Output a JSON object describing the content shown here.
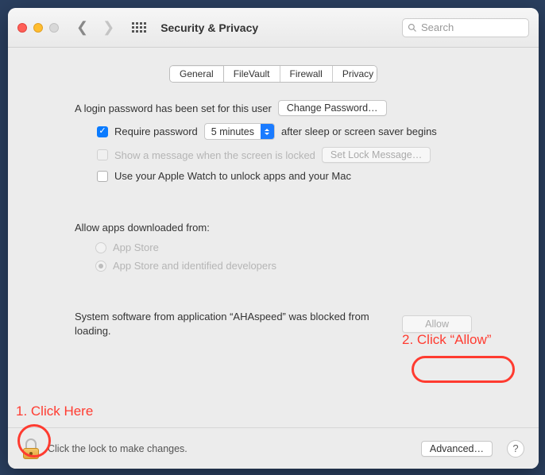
{
  "window": {
    "title": "Security & Privacy",
    "search_placeholder": "Search"
  },
  "tabs": {
    "general": "General",
    "filevault": "FileVault",
    "firewall": "Firewall",
    "privacy": "Privacy"
  },
  "login": {
    "password_set_text": "A login password has been set for this user",
    "change_password_btn": "Change Password…",
    "require_password_label": "Require password",
    "delay_value": "5 minutes",
    "after_sleep_text": "after sleep or screen saver begins",
    "show_message_label": "Show a message when the screen is locked",
    "set_lock_message_btn": "Set Lock Message…",
    "apple_watch_label": "Use your Apple Watch to unlock apps and your Mac"
  },
  "download": {
    "header": "Allow apps downloaded from:",
    "opt_appstore": "App Store",
    "opt_identified": "App Store and identified developers"
  },
  "blocked": {
    "text": "System software from application “AHAspeed” was blocked from loading.",
    "allow_btn": "Allow"
  },
  "footer": {
    "lock_text": "Click the lock to make changes.",
    "advanced_btn": "Advanced…"
  },
  "annotations": {
    "step1": "1. Click Here",
    "step2": "2. Click “Allow”"
  }
}
